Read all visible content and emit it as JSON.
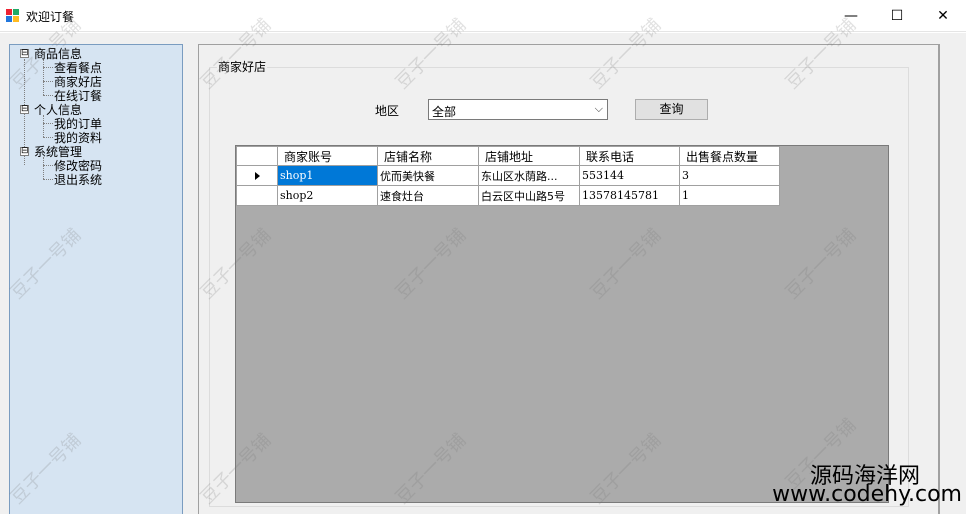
{
  "window": {
    "title": "欢迎订餐",
    "controls": {
      "minimize": "—",
      "maximize": "☐",
      "close": "✕"
    }
  },
  "tree": {
    "groups": [
      {
        "label": "商品信息",
        "toggle": "⊟",
        "children": [
          "查看餐点",
          "商家好店",
          "在线订餐"
        ]
      },
      {
        "label": "个人信息",
        "toggle": "⊟",
        "children": [
          "我的订单",
          "我的资料"
        ]
      },
      {
        "label": "系统管理",
        "toggle": "⊟",
        "children": [
          "修改密码",
          "退出系统"
        ]
      }
    ]
  },
  "panel": {
    "title": "商家好店",
    "region_label": "地区",
    "region_value": "全部",
    "query_label": "查询"
  },
  "grid": {
    "columns": [
      "商家账号",
      "店铺名称",
      "店铺地址",
      "联系电话",
      "出售餐点数量"
    ],
    "rows": [
      [
        "shop1",
        "优而美快餐",
        "东山区水荫路...",
        "553144",
        "3"
      ],
      [
        "shop2",
        "速食灶台",
        "白云区中山路5号",
        "13578145781",
        "1"
      ]
    ],
    "selected_row": 0
  },
  "watermark": "豆子一号铺",
  "branding": {
    "name": "源码海洋网",
    "url": "www.codehy.com"
  },
  "colors": {
    "selection": "#0078d7",
    "tree_bg": "#d6e4f2",
    "grid_bg": "#ababab"
  }
}
